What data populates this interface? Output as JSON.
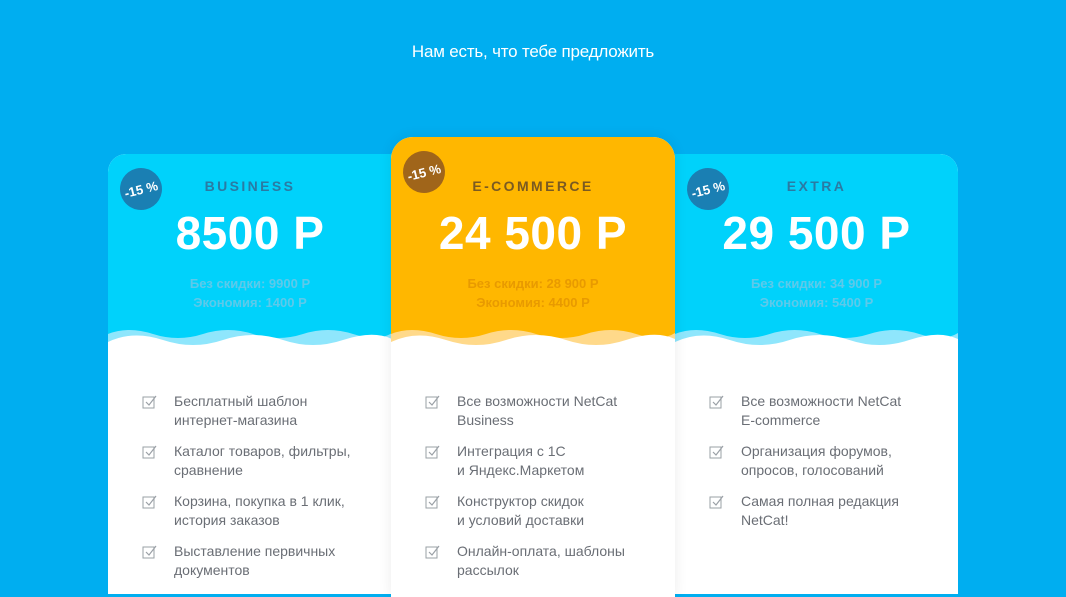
{
  "heading": "Нам есть, что тебе предложить",
  "colors": {
    "background": "#00aef0",
    "card_blue": "#00d2fb",
    "card_orange": "#ffb700",
    "text_gray": "#6a6e75"
  },
  "plans": [
    {
      "badge": "-15 %",
      "name": "BUSINESS",
      "price": "8500 Р",
      "without_discount": "Без скидки: 9900 Р",
      "savings": "Экономия: 1400 Р",
      "features": [
        {
          "line1": "Бесплатный шаблон",
          "line2": "интернет-магазина"
        },
        {
          "line1": "Каталог товаров, фильтры,",
          "line2": "сравнение"
        },
        {
          "line1": "Корзина, покупка в 1 клик,",
          "line2": "история заказов"
        },
        {
          "line1": "Выставление первичных",
          "line2": "документов"
        }
      ]
    },
    {
      "badge": "-15 %",
      "name": "E-COMMERCE",
      "price": "24 500 Р",
      "without_discount": "Без скидки: 28 900 Р",
      "savings": "Экономия: 4400 Р",
      "features": [
        {
          "line1": "Все возможности NetCat",
          "line2": "Business"
        },
        {
          "line1": "Интеграция с 1С",
          "line2": "и Яндекс.Маркетом"
        },
        {
          "line1": "Конструктор скидок",
          "line2": "и условий доставки"
        },
        {
          "line1": "Онлайн-оплата, шаблоны",
          "line2": "рассылок"
        }
      ]
    },
    {
      "badge": "-15 %",
      "name": "EXTRA",
      "price": "29 500 Р",
      "without_discount": "Без скидки: 34 900 Р",
      "savings": "Экономия: 5400 Р",
      "features": [
        {
          "line1": "Все возможности NetCat",
          "line2": "E-commerce"
        },
        {
          "line1": "Организация форумов,",
          "line2": "опросов, голосований"
        },
        {
          "line1": "Самая полная редакция",
          "line2": "NetCat!"
        }
      ]
    }
  ]
}
